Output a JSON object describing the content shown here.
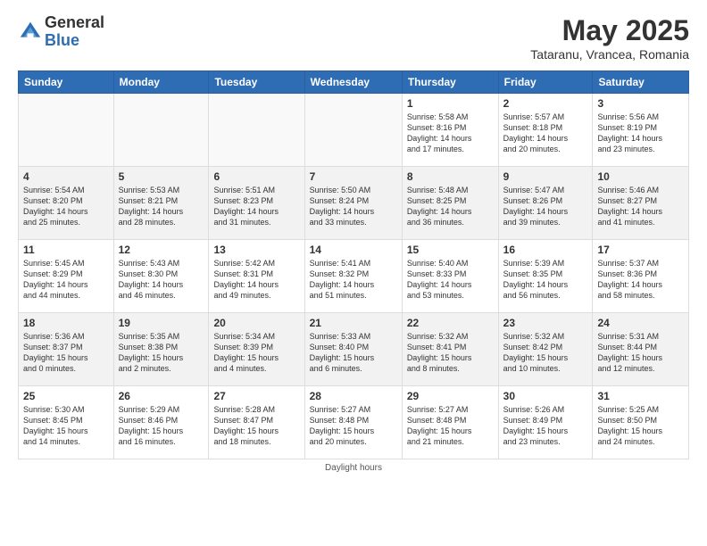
{
  "logo": {
    "general": "General",
    "blue": "Blue"
  },
  "title": "May 2025",
  "subtitle": "Tataranu, Vrancea, Romania",
  "days_header": [
    "Sunday",
    "Monday",
    "Tuesday",
    "Wednesday",
    "Thursday",
    "Friday",
    "Saturday"
  ],
  "weeks": [
    [
      {
        "num": "",
        "info": ""
      },
      {
        "num": "",
        "info": ""
      },
      {
        "num": "",
        "info": ""
      },
      {
        "num": "",
        "info": ""
      },
      {
        "num": "1",
        "info": "Sunrise: 5:58 AM\nSunset: 8:16 PM\nDaylight: 14 hours\nand 17 minutes."
      },
      {
        "num": "2",
        "info": "Sunrise: 5:57 AM\nSunset: 8:18 PM\nDaylight: 14 hours\nand 20 minutes."
      },
      {
        "num": "3",
        "info": "Sunrise: 5:56 AM\nSunset: 8:19 PM\nDaylight: 14 hours\nand 23 minutes."
      }
    ],
    [
      {
        "num": "4",
        "info": "Sunrise: 5:54 AM\nSunset: 8:20 PM\nDaylight: 14 hours\nand 25 minutes."
      },
      {
        "num": "5",
        "info": "Sunrise: 5:53 AM\nSunset: 8:21 PM\nDaylight: 14 hours\nand 28 minutes."
      },
      {
        "num": "6",
        "info": "Sunrise: 5:51 AM\nSunset: 8:23 PM\nDaylight: 14 hours\nand 31 minutes."
      },
      {
        "num": "7",
        "info": "Sunrise: 5:50 AM\nSunset: 8:24 PM\nDaylight: 14 hours\nand 33 minutes."
      },
      {
        "num": "8",
        "info": "Sunrise: 5:48 AM\nSunset: 8:25 PM\nDaylight: 14 hours\nand 36 minutes."
      },
      {
        "num": "9",
        "info": "Sunrise: 5:47 AM\nSunset: 8:26 PM\nDaylight: 14 hours\nand 39 minutes."
      },
      {
        "num": "10",
        "info": "Sunrise: 5:46 AM\nSunset: 8:27 PM\nDaylight: 14 hours\nand 41 minutes."
      }
    ],
    [
      {
        "num": "11",
        "info": "Sunrise: 5:45 AM\nSunset: 8:29 PM\nDaylight: 14 hours\nand 44 minutes."
      },
      {
        "num": "12",
        "info": "Sunrise: 5:43 AM\nSunset: 8:30 PM\nDaylight: 14 hours\nand 46 minutes."
      },
      {
        "num": "13",
        "info": "Sunrise: 5:42 AM\nSunset: 8:31 PM\nDaylight: 14 hours\nand 49 minutes."
      },
      {
        "num": "14",
        "info": "Sunrise: 5:41 AM\nSunset: 8:32 PM\nDaylight: 14 hours\nand 51 minutes."
      },
      {
        "num": "15",
        "info": "Sunrise: 5:40 AM\nSunset: 8:33 PM\nDaylight: 14 hours\nand 53 minutes."
      },
      {
        "num": "16",
        "info": "Sunrise: 5:39 AM\nSunset: 8:35 PM\nDaylight: 14 hours\nand 56 minutes."
      },
      {
        "num": "17",
        "info": "Sunrise: 5:37 AM\nSunset: 8:36 PM\nDaylight: 14 hours\nand 58 minutes."
      }
    ],
    [
      {
        "num": "18",
        "info": "Sunrise: 5:36 AM\nSunset: 8:37 PM\nDaylight: 15 hours\nand 0 minutes."
      },
      {
        "num": "19",
        "info": "Sunrise: 5:35 AM\nSunset: 8:38 PM\nDaylight: 15 hours\nand 2 minutes."
      },
      {
        "num": "20",
        "info": "Sunrise: 5:34 AM\nSunset: 8:39 PM\nDaylight: 15 hours\nand 4 minutes."
      },
      {
        "num": "21",
        "info": "Sunrise: 5:33 AM\nSunset: 8:40 PM\nDaylight: 15 hours\nand 6 minutes."
      },
      {
        "num": "22",
        "info": "Sunrise: 5:32 AM\nSunset: 8:41 PM\nDaylight: 15 hours\nand 8 minutes."
      },
      {
        "num": "23",
        "info": "Sunrise: 5:32 AM\nSunset: 8:42 PM\nDaylight: 15 hours\nand 10 minutes."
      },
      {
        "num": "24",
        "info": "Sunrise: 5:31 AM\nSunset: 8:44 PM\nDaylight: 15 hours\nand 12 minutes."
      }
    ],
    [
      {
        "num": "25",
        "info": "Sunrise: 5:30 AM\nSunset: 8:45 PM\nDaylight: 15 hours\nand 14 minutes."
      },
      {
        "num": "26",
        "info": "Sunrise: 5:29 AM\nSunset: 8:46 PM\nDaylight: 15 hours\nand 16 minutes."
      },
      {
        "num": "27",
        "info": "Sunrise: 5:28 AM\nSunset: 8:47 PM\nDaylight: 15 hours\nand 18 minutes."
      },
      {
        "num": "28",
        "info": "Sunrise: 5:27 AM\nSunset: 8:48 PM\nDaylight: 15 hours\nand 20 minutes."
      },
      {
        "num": "29",
        "info": "Sunrise: 5:27 AM\nSunset: 8:48 PM\nDaylight: 15 hours\nand 21 minutes."
      },
      {
        "num": "30",
        "info": "Sunrise: 5:26 AM\nSunset: 8:49 PM\nDaylight: 15 hours\nand 23 minutes."
      },
      {
        "num": "31",
        "info": "Sunrise: 5:25 AM\nSunset: 8:50 PM\nDaylight: 15 hours\nand 24 minutes."
      }
    ]
  ],
  "footer": "Daylight hours"
}
